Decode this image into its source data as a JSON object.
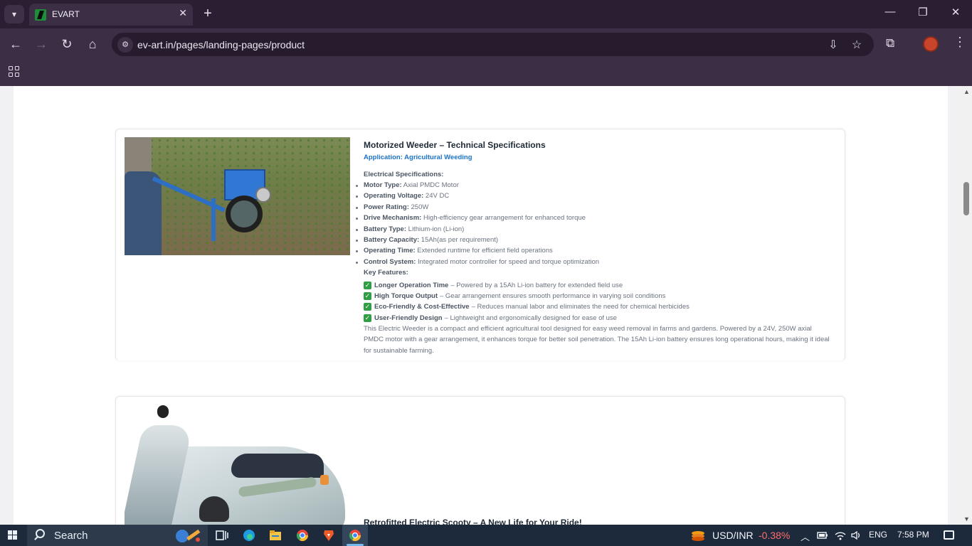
{
  "browser": {
    "tab_title": "EVART",
    "url": "ev-art.in/pages/landing-pages/product"
  },
  "weeder": {
    "title": "Motorized Weeder – Technical Specifications",
    "application": "Application: Agricultural Weeding",
    "electrical_heading": "Electrical Specifications:",
    "specs": [
      {
        "label": "Motor Type:",
        "value": " Axial PMDC Motor"
      },
      {
        "label": "Operating Voltage:",
        "value": " 24V DC"
      },
      {
        "label": "Power Rating:",
        "value": " 250W"
      },
      {
        "label": "Drive Mechanism:",
        "value": " High-efficiency gear arrangement for enhanced torque"
      },
      {
        "label": "Battery Type:",
        "value": " Lithium-ion (Li-ion)"
      },
      {
        "label": "Battery Capacity:",
        "value": " 15Ah(as per requirement)"
      },
      {
        "label": "Operating Time:",
        "value": " Extended runtime for efficient field operations"
      },
      {
        "label": "Control System:",
        "value": " Integrated motor controller for speed and torque optimization"
      }
    ],
    "features_heading": "Key Features:",
    "features": [
      {
        "label": "Longer Operation Time",
        "value": "– Powered by a 15Ah Li-ion battery for extended field use"
      },
      {
        "label": "High Torque Output",
        "value": "– Gear arrangement ensures smooth performance in varying soil conditions"
      },
      {
        "label": "Eco-Friendly & Cost-Effective",
        "value": "– Reduces manual labor and eliminates the need for chemical herbicides"
      },
      {
        "label": "User-Friendly Design",
        "value": "– Lightweight and ergonomically designed for ease of use"
      }
    ],
    "description": "This Electric Weeder is a compact and efficient agricultural tool designed for easy weed removal in farms and gardens. Powered by a 24V, 250W axial PMDC motor with a gear arrangement, it enhances torque for better soil penetration. The 15Ah Li-ion battery ensures long operational hours, making it ideal for sustainable farming."
  },
  "scooty": {
    "title": "Retrofitted Electric Scooty – A New Life for Your Ride!"
  },
  "taskbar": {
    "search_label": "Search",
    "stock_symbol": "USD/INR",
    "stock_change": "-0.38%",
    "language": "ENG",
    "time": "7:58 PM"
  },
  "icons": {
    "tab_list": "chevron-down-icon",
    "close": "close-icon",
    "new_tab": "plus-icon",
    "back": "arrow-left-icon",
    "forward": "arrow-right-icon",
    "reload": "reload-icon",
    "home": "home-icon",
    "install": "install-icon",
    "bookmark": "star-icon",
    "extensions": "puzzle-icon",
    "menu": "more-vertical-icon"
  },
  "colors": {
    "chrome_bg": "#3b2e45",
    "tab_strip": "#2b1e33",
    "accent_link": "#1a73c9",
    "feature_check": "#2f9e44",
    "taskbar_bg": "#1c2a3c",
    "stock_negative": "#ff6b6b"
  }
}
